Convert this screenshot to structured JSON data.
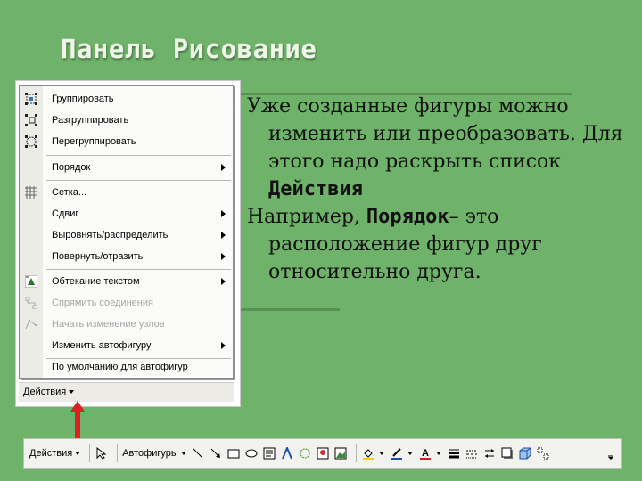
{
  "slide": {
    "title": "Панель Рисование",
    "paragraph1": {
      "text": "Уже созданные фигуры можно изменить или преобразовать. Для этого надо раскрыть список ",
      "bold": "Действия"
    },
    "paragraph2": {
      "prefix": "Например, ",
      "bold": "Порядок",
      "text": "– это расположение фигур друг относительно друга."
    }
  },
  "menu": {
    "items": [
      {
        "label": "Группировать",
        "icon": "group-icon"
      },
      {
        "label": "Разгруппировать",
        "icon": "ungroup-icon"
      },
      {
        "label": "Перегруппировать",
        "icon": "regroup-icon"
      },
      {
        "label": "Порядок",
        "icon": "",
        "submenu": true
      },
      {
        "label": "Сетка...",
        "icon": "grid-icon"
      },
      {
        "label": "Сдвиг",
        "icon": "",
        "submenu": true
      },
      {
        "label": "Выровнять/распределить",
        "icon": "",
        "submenu": true
      },
      {
        "label": "Повернуть/отразить",
        "icon": "",
        "submenu": true
      },
      {
        "label": "Обтекание текстом",
        "icon": "text-wrap-icon",
        "submenu": true
      },
      {
        "label": "Спрямить соединения",
        "icon": "reroute-connectors-icon",
        "disabled": true
      },
      {
        "label": "Начать изменение узлов",
        "icon": "edit-points-icon",
        "disabled": true
      },
      {
        "label": "Изменить автофигуру",
        "icon": "",
        "submenu": true
      },
      {
        "label": "По умолчанию для автофигур",
        "icon": ""
      }
    ],
    "footer_button": "Действия"
  },
  "toolbar": {
    "actions_label": "Действия",
    "autoshapes_label": "Автофигуры",
    "icons": [
      "select-arrow-icon",
      "line-icon",
      "arrow-icon",
      "rectangle-icon",
      "oval-icon",
      "text-box-icon",
      "wordart-icon",
      "diagram-icon",
      "clip-art-icon",
      "picture-icon",
      "fill-color-icon",
      "line-color-icon",
      "font-color-icon",
      "line-style-icon",
      "dash-style-icon",
      "arrow-style-icon",
      "shadow-icon",
      "3d-icon",
      "more-icon"
    ]
  },
  "colors": {
    "background": "#6fb26a",
    "pointer_arrow": "#e02020"
  }
}
